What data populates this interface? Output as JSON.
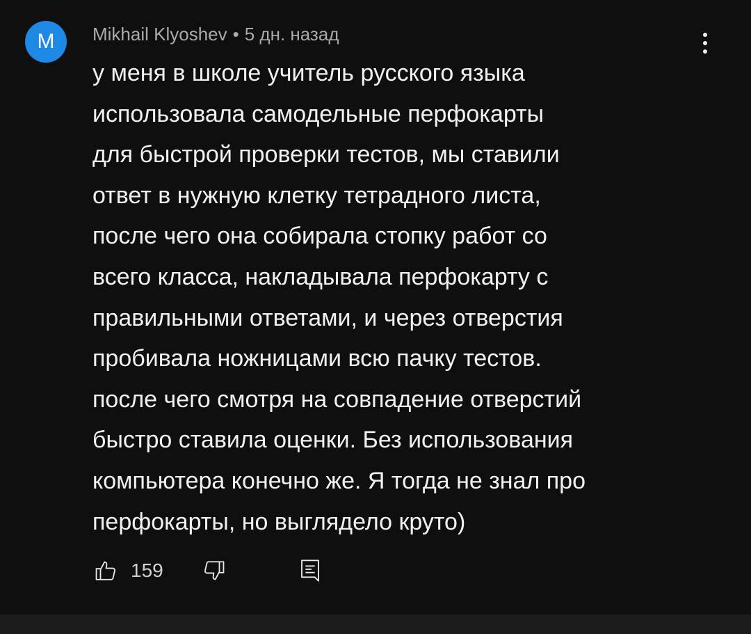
{
  "comment": {
    "avatar_letter": "M",
    "author": "Mikhail Klyoshev",
    "separator": "•",
    "time": "5 дн. назад",
    "lines": [
      "у меня в школе учитель русского языка",
      "использовала самодельные перфокарты",
      "для быстрой проверки тестов, мы ставили",
      "ответ в нужную клетку тетрадного листа,",
      "после чего она собирала стопку работ со",
      "всего класса, накладывала перфокарту с",
      "правильными ответами, и через отверстия",
      "пробивала ножницами всю пачку тестов.",
      "после чего смотря на совпадение отверстий",
      "быстро ставила оценки. Без использования",
      "компьютера конечно же. Я тогда не знал про",
      "перфокарты, но выглядело круто)"
    ],
    "like_count": "159"
  },
  "icons": {
    "like": "thumb-up-icon",
    "dislike": "thumb-down-icon",
    "reply": "reply-comment-icon",
    "more": "more-vert-icon"
  },
  "colors": {
    "background": "#0f0f0f",
    "avatar": "#1e88e5",
    "text": "#f1f1f1",
    "meta_text": "#aaaaaa",
    "bottom_strip": "#1c1c1c"
  }
}
